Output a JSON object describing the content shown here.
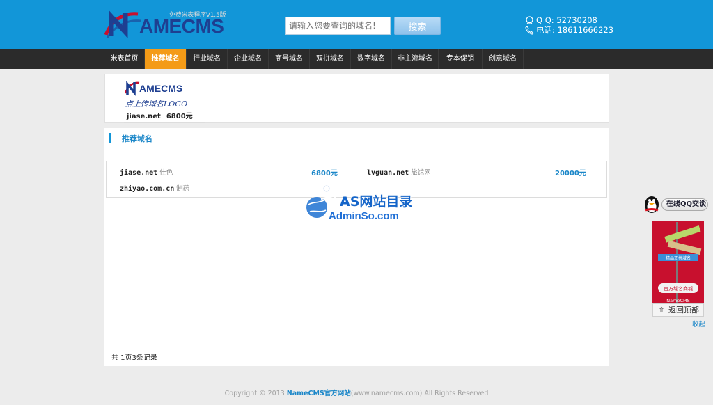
{
  "header": {
    "logo_text": "AMECMS",
    "slogan": "免费米表程序V1.5版",
    "search_placeholder": "请输入您要查询的域名!",
    "search_button": "搜索",
    "qq": "Q Q: 52730208",
    "phone": "电话: 18611666223"
  },
  "nav": {
    "items": [
      {
        "label": "米表首页"
      },
      {
        "label": "推荐域名"
      },
      {
        "label": "行业域名"
      },
      {
        "label": "企业域名"
      },
      {
        "label": "商号域名"
      },
      {
        "label": "双拼域名"
      },
      {
        "label": "数字域名"
      },
      {
        "label": "非主流域名"
      },
      {
        "label": "专本促销"
      },
      {
        "label": "创意域名"
      }
    ],
    "active_index": 1
  },
  "ad": {
    "logo_text": "AMECMS",
    "subtitle": "点上传域名LOGO",
    "domain": "jiase.net",
    "price": "6800元"
  },
  "section": {
    "title": "推荐域名"
  },
  "domains": [
    {
      "name": "jiase.net",
      "desc": "佳色",
      "price": "6800元"
    },
    {
      "name": "lvguan.net",
      "desc": "旅馆网",
      "price": "20000元"
    },
    {
      "name": "zhiyao.com.cn",
      "desc": "制药",
      "price": ""
    }
  ],
  "pager": {
    "text": "共 1页3条记录"
  },
  "watermark": {
    "line1": "AS网站目录",
    "line2": "AdminSo.com"
  },
  "footer": {
    "prefix": "Copyright © 2013 ",
    "brand": "NameCMS官方网站",
    "site": "(www.namecms.com)",
    "suffix": " All Rights Reserved"
  },
  "side": {
    "qq_label": "在线QQ交谈",
    "ad_sign1": "精品双拼域名",
    "ad_sign2": "官方域名商城",
    "ad_brand": "NameCMS",
    "back_top": "返回顶部",
    "collapse": "收起"
  },
  "colors": {
    "header_bg": "#1296d8",
    "nav_bg": "#2b2b2b",
    "nav_active": "#f49b17",
    "accent_text": "#1a86c8",
    "side_ad": "#c8102e"
  }
}
